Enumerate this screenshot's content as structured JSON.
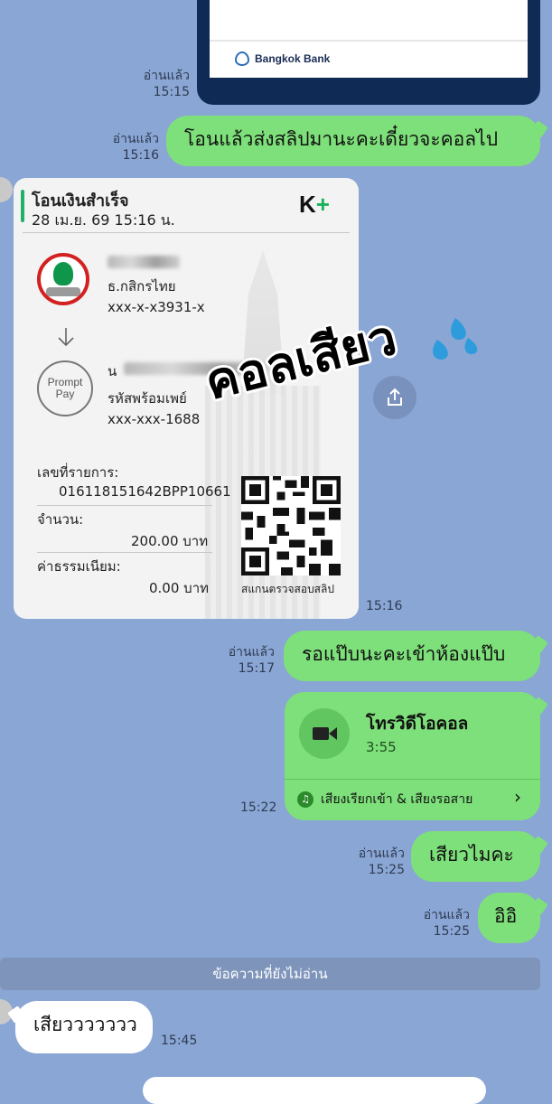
{
  "top_card": {
    "bank_name": "Bangkok Bank"
  },
  "messages": [
    {
      "read": "อ่านแล้ว",
      "time": "15:15"
    },
    {
      "read": "อ่านแล้ว",
      "time": "15:16",
      "text": "โอนแล้วส่งสลิปมานะคะเดี๋ยวจะคอลไป"
    },
    {
      "time": "15:16"
    },
    {
      "read": "อ่านแล้ว",
      "time": "15:17",
      "text": "รอแป๊บนะคะเข้าห้องแป๊บ"
    },
    {
      "time": "15:22"
    },
    {
      "read": "อ่านแล้ว",
      "time": "15:25",
      "text": "เสียวไมคะ"
    },
    {
      "read": "อ่านแล้ว",
      "time": "15:25",
      "text": "อิอิ"
    },
    {
      "time": "15:45",
      "text": "เสียววววววว"
    }
  ],
  "slip": {
    "title": "โอนเงินสำเร็จ",
    "datetime": "28 เม.ย. 69 15:16 น.",
    "logo": "K+",
    "from_bank": "ธ.กสิกรไทย",
    "from_account": "xxx-x-x3931-x",
    "to_label": "รหัสพร้อมเพย์",
    "to_account": "xxx-xxx-1688",
    "to_prefix": "น",
    "promptpay_logo": "Prompt Pay",
    "ref_label": "เลขที่รายการ:",
    "ref_value": "016118151642BPP10661",
    "amount_label": "จำนวน:",
    "amount_value": "200.00 บาท",
    "fee_label": "ค่าธรรมเนียม:",
    "fee_value": "0.00 บาท",
    "qr_caption": "สแกนตรวจสอบสลิป"
  },
  "overlay": {
    "text": "คอลเสียว"
  },
  "video_call": {
    "title": "โทรวิดีโอคอล",
    "duration": "3:55",
    "footer": "เสียงเรียกเข้า & เสียงรอสาย",
    "chevron": "›"
  },
  "unread_separator": "ข้อความที่ยังไม่อ่าน",
  "icons": [
    "share-icon",
    "video-camera-icon",
    "music-note-icon",
    "chevron-right-icon",
    "arrow-down-icon"
  ],
  "colors": {
    "chat_bg": "#8aa6d4",
    "bubble_green": "#7ee07a",
    "kbank_green": "#10964a"
  }
}
